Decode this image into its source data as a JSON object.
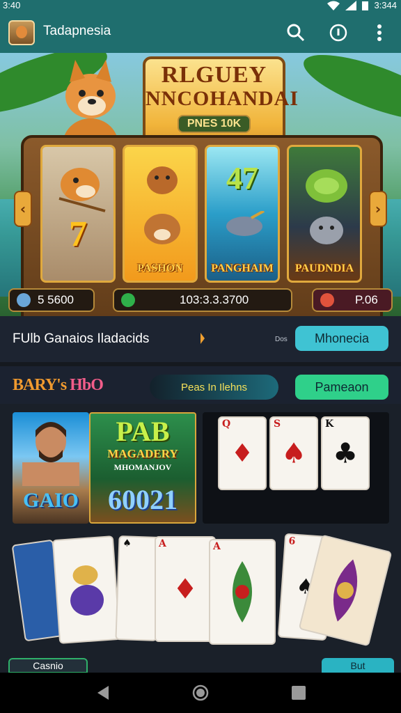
{
  "status_bar": {
    "time": "3:40",
    "battery": "3:344"
  },
  "app_bar": {
    "title": "Tadapnesia"
  },
  "hero": {
    "title_line1": "RLGUEY",
    "title_line2": "NNCOHANDAI",
    "subtitle": "PNES 10K",
    "reels": [
      {
        "symbol": "7",
        "label": ""
      },
      {
        "symbol": "",
        "label": "PASHON"
      },
      {
        "symbol": "47",
        "label": "PANGHAIM"
      },
      {
        "symbol": "",
        "label": "PAUDNDIA"
      }
    ],
    "left_arrow": "‹",
    "right_arrow": "›",
    "balance": "5 5600",
    "win_readout": "103:3.3.3700",
    "bet": "P.06"
  },
  "promo": {
    "text": "FUlb Ganaios Iladacids",
    "small_label": "Dos",
    "button": "Mhonecia"
  },
  "section2": {
    "logo_left": "BARY's",
    "logo_right": "HbO",
    "search_text": "Peas In Ilehns",
    "button": "Pameaon"
  },
  "games": {
    "card_a_label": "GAIO",
    "card_b_title": "PAB",
    "card_b_sub": "MAGADERY",
    "card_b_sub2": "MHOMANJOV",
    "card_b_num": "60021",
    "dark_cards": [
      {
        "rank": "Q",
        "suit": "♦",
        "color": "red"
      },
      {
        "rank": "S",
        "suit": "♠",
        "color": "red"
      },
      {
        "rank": "K",
        "suit": "♣",
        "color": "black"
      }
    ],
    "fan_cards": [
      {
        "rank": "",
        "suit": "",
        "color": "red"
      },
      {
        "rank": "",
        "suit": "",
        "color": "red"
      },
      {
        "rank": "♠",
        "suit": "",
        "color": "black"
      },
      {
        "rank": "A",
        "suit": "♦",
        "color": "red"
      },
      {
        "rank": "A",
        "suit": "♦",
        "color": "red"
      },
      {
        "rank": "6",
        "suit": "♠",
        "color": "black"
      },
      {
        "rank": "",
        "suit": "",
        "color": "red"
      }
    ]
  },
  "bottom": {
    "left_button": "Casnio",
    "right_button": "But"
  },
  "colors": {
    "teal": "#1f6e6e",
    "pill_teal": "#3fc3d3",
    "pill_green": "#2fd08a",
    "gold": "#ffd447"
  },
  "icons": [
    "search-icon",
    "info-icon",
    "more-vert-icon",
    "back-icon",
    "home-icon",
    "recents-icon"
  ]
}
